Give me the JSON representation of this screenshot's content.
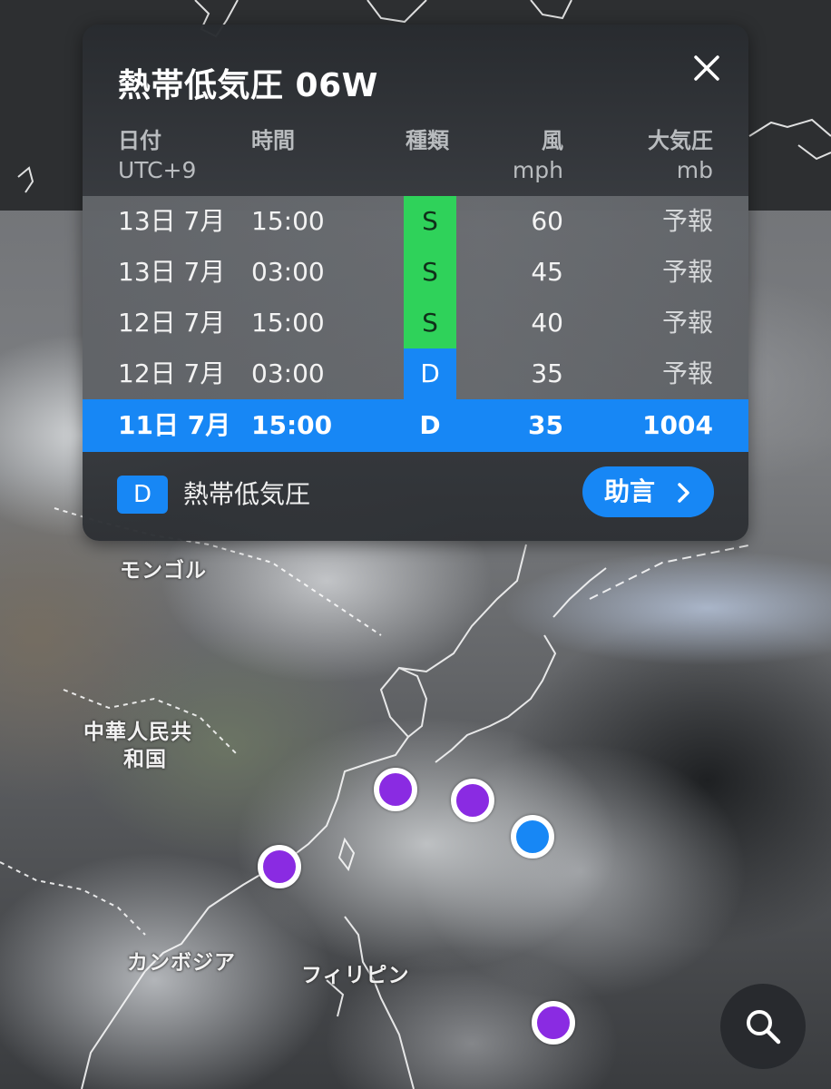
{
  "panel": {
    "title": "熱帯低気圧 06W",
    "headers": {
      "date": "日付",
      "time": "時間",
      "type": "種類",
      "wind": "風",
      "pressure": "大気圧"
    },
    "subheaders": {
      "date": "UTC+9",
      "wind": "mph",
      "pressure": "mb"
    },
    "rows": [
      {
        "date": "13日 7月",
        "time": "15:00",
        "type": "S",
        "wind": "60",
        "pressure": "予報"
      },
      {
        "date": "13日 7月",
        "time": "03:00",
        "type": "S",
        "wind": "45",
        "pressure": "予報"
      },
      {
        "date": "12日 7月",
        "time": "15:00",
        "type": "S",
        "wind": "40",
        "pressure": "予報"
      },
      {
        "date": "12日 7月",
        "time": "03:00",
        "type": "D",
        "wind": "35",
        "pressure": "予報"
      },
      {
        "date": "11日 7月",
        "time": "15:00",
        "type": "D",
        "wind": "35",
        "pressure": "1004"
      }
    ],
    "legend": {
      "badge": "D",
      "label": "熱帯低気圧"
    },
    "advice_button": "助言",
    "close_icon": "close-icon"
  },
  "map": {
    "labels": {
      "mongolia": "モンゴル",
      "china_line1": "中華人民共",
      "china_line2": "和国",
      "cambodia": "カンボジア",
      "philippines": "フィリピン"
    },
    "storm_markers": [
      {
        "color": "#8a2be2"
      },
      {
        "color": "#8a2be2"
      },
      {
        "color": "#1787f5"
      },
      {
        "color": "#8a2be2"
      },
      {
        "color": "#8a2be2"
      }
    ]
  },
  "colors": {
    "accent_blue": "#1787f5",
    "storm_green": "#2fd25a",
    "marker_purple": "#8a2be2"
  },
  "icons": {
    "search": "search-icon",
    "chevron": "chevron-right-icon"
  }
}
